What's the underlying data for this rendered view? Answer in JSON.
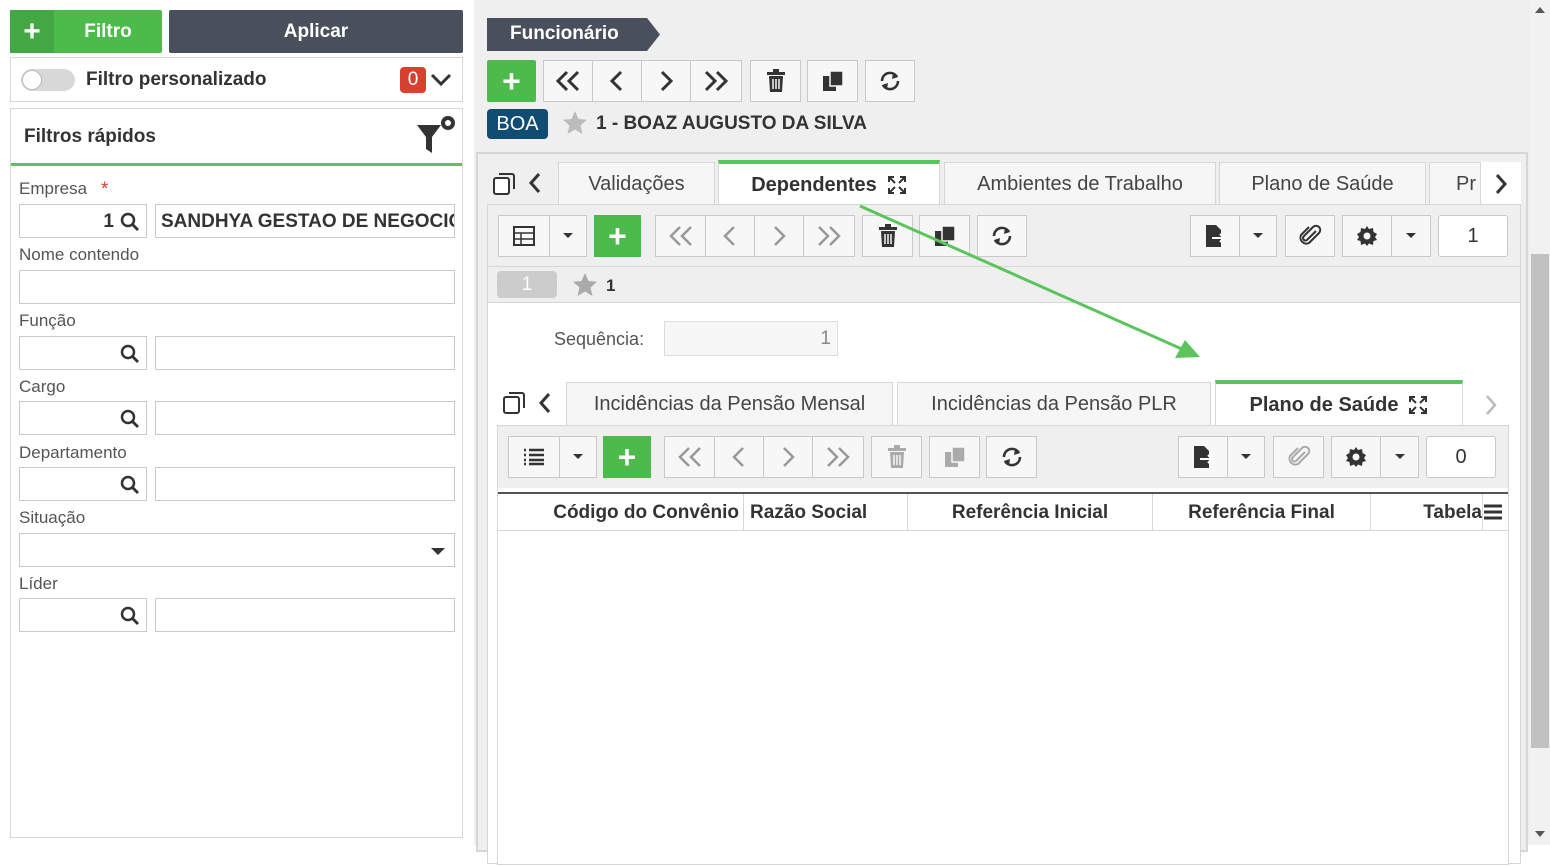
{
  "filter_panel": {
    "add_filter_label": "Filtro",
    "apply_label": "Aplicar",
    "custom_filter_label": "Filtro personalizado",
    "custom_filter_count": "0",
    "quick_filters_title": "Filtros rápidos",
    "fields": {
      "empresa_label": "Empresa",
      "empresa_required": "*",
      "empresa_code": "1",
      "empresa_name": "SANDHYA GESTAO DE NEGOCIOS",
      "nome_label": "Nome contendo",
      "funcao_label": "Função",
      "cargo_label": "Cargo",
      "departamento_label": "Departamento",
      "situacao_label": "Situação",
      "lider_label": "Líder"
    }
  },
  "record": {
    "breadcrumb": "Funcionário",
    "badge": "BOA",
    "title": "1 - BOAZ AUGUSTO DA SILVA"
  },
  "outer_tabs": [
    "Validações",
    "Dependentes",
    "Ambientes de Trabalho",
    "Plano de Saúde",
    "Pr"
  ],
  "dependentes": {
    "counter": "1",
    "sub_badge": "1",
    "sub_title": "1",
    "sequencia_label": "Sequência:",
    "sequencia_value": "1"
  },
  "inner_tabs": [
    "Incidências da Pensão Mensal",
    "Incidências da Pensão PLR",
    "Plano de Saúde"
  ],
  "plano": {
    "counter": "0",
    "columns": [
      "Código do Convênio",
      "Razão Social",
      "Referência Inicial",
      "Referência Final",
      "Tabela"
    ]
  },
  "colors": {
    "green": "#4cbb4c",
    "dark_button": "#4a505b",
    "badge_blue": "#114d73",
    "counter_red": "#d9412f"
  }
}
